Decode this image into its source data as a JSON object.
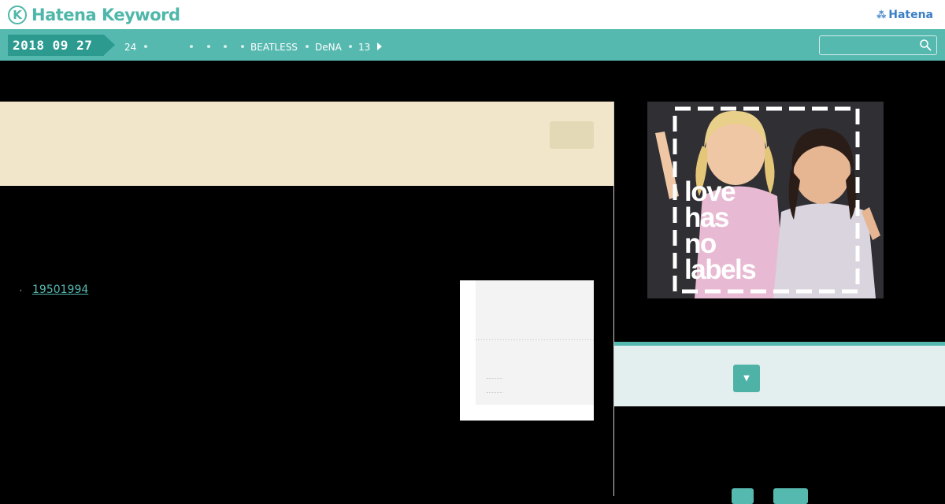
{
  "header": {
    "logo_mark": "K",
    "logo_text": "Hatena Keyword",
    "hatena_icon": "⁂",
    "hatena_link": "Hatena"
  },
  "nav": {
    "date": "2018 09 27",
    "items": [
      "24",
      "BEATLESS",
      "DeNA",
      "13"
    ]
  },
  "search": {
    "placeholder": "",
    "value": ""
  },
  "content": {
    "year_prefix": ",",
    "year_link": "19501994"
  },
  "sidebar": {
    "ad_caption": [
      "love",
      "has",
      "no",
      "labels"
    ],
    "dropdown_icon": "▼"
  },
  "colors": {
    "brand": "#56b9b0",
    "brand_dark": "#2c9a8f",
    "beige": "#f1e6ca",
    "hatena_blue": "#3a7fc7"
  }
}
